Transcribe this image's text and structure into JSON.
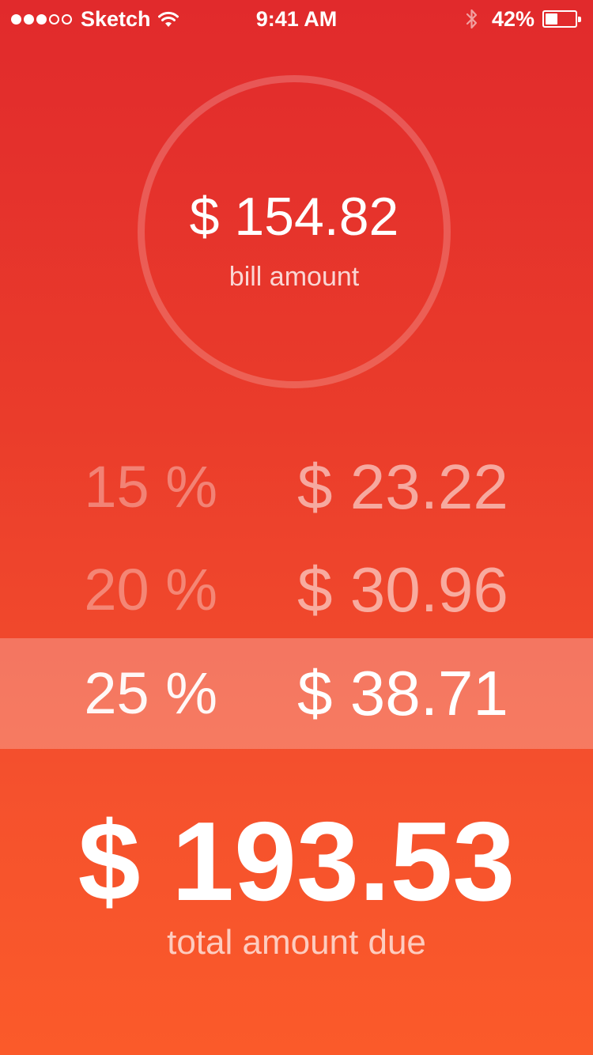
{
  "status_bar": {
    "signal_full": 3,
    "signal_total": 5,
    "carrier": "Sketch",
    "time": "9:41 AM",
    "battery_percent": "42%",
    "battery_level": 0.42,
    "icons": [
      "wifi-icon",
      "bluetooth-icon",
      "battery-icon"
    ]
  },
  "bill": {
    "amount": "$ 154.82",
    "label": "bill amount"
  },
  "tips": [
    {
      "percent": "15 %",
      "amount": "$ 23.22",
      "selected": false
    },
    {
      "percent": "20 %",
      "amount": "$ 30.96",
      "selected": false
    },
    {
      "percent": "25 %",
      "amount": "$ 38.71",
      "selected": true
    }
  ],
  "total": {
    "amount": "$ 193.53",
    "label": "total amount due"
  },
  "colors": {
    "gradient_top": "#e12a2c",
    "gradient_bottom": "#fb5a2a",
    "text": "#ffffff"
  }
}
